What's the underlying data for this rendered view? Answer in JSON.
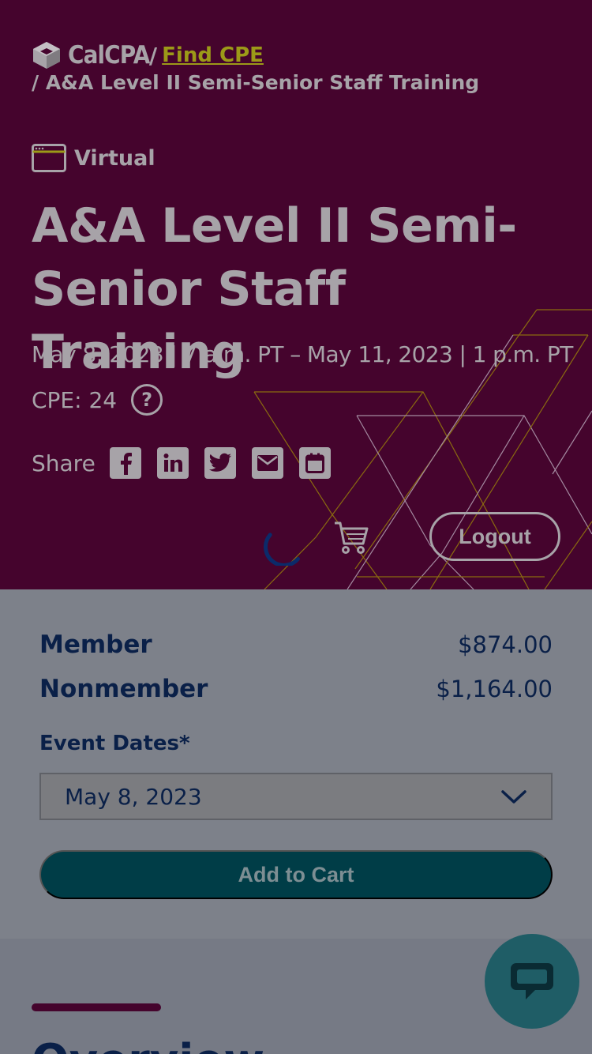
{
  "breadcrumb": {
    "logo_text": "CalCPA",
    "separator": "/",
    "link_label": "Find CPE",
    "current": "/ A&A Level II Semi-Senior Staff Training"
  },
  "event": {
    "format": "Virtual",
    "title": "A&A Level II Semi-Senior Staff Training",
    "dates": "May 8, 2023 | 7 a.m. PT – May 11, 2023 | 1 p.m. PT",
    "cpe": "CPE: 24",
    "help_icon_glyph": "?",
    "share_label": "Share",
    "share_icons": [
      "facebook-icon",
      "linkedin-icon",
      "twitter-icon",
      "email-icon",
      "calendar-icon"
    ]
  },
  "header_actions": {
    "logout_label": "Logout"
  },
  "pricing": {
    "member_label": "Member",
    "member_price": "$874.00",
    "nonmember_label": "Nonmember",
    "nonmember_price": "$1,164.00",
    "event_dates_label": "Event Dates*",
    "selected_date": "May 8, 2023",
    "add_to_cart_label": "Add to Cart"
  },
  "overview": {
    "title": "Overview"
  },
  "colors": {
    "hero_background": "#45042d",
    "link_accent": "#9c9a18",
    "navy_text": "#0a2048",
    "cart_button": "#003d47",
    "chat_button": "#1f5d66"
  }
}
